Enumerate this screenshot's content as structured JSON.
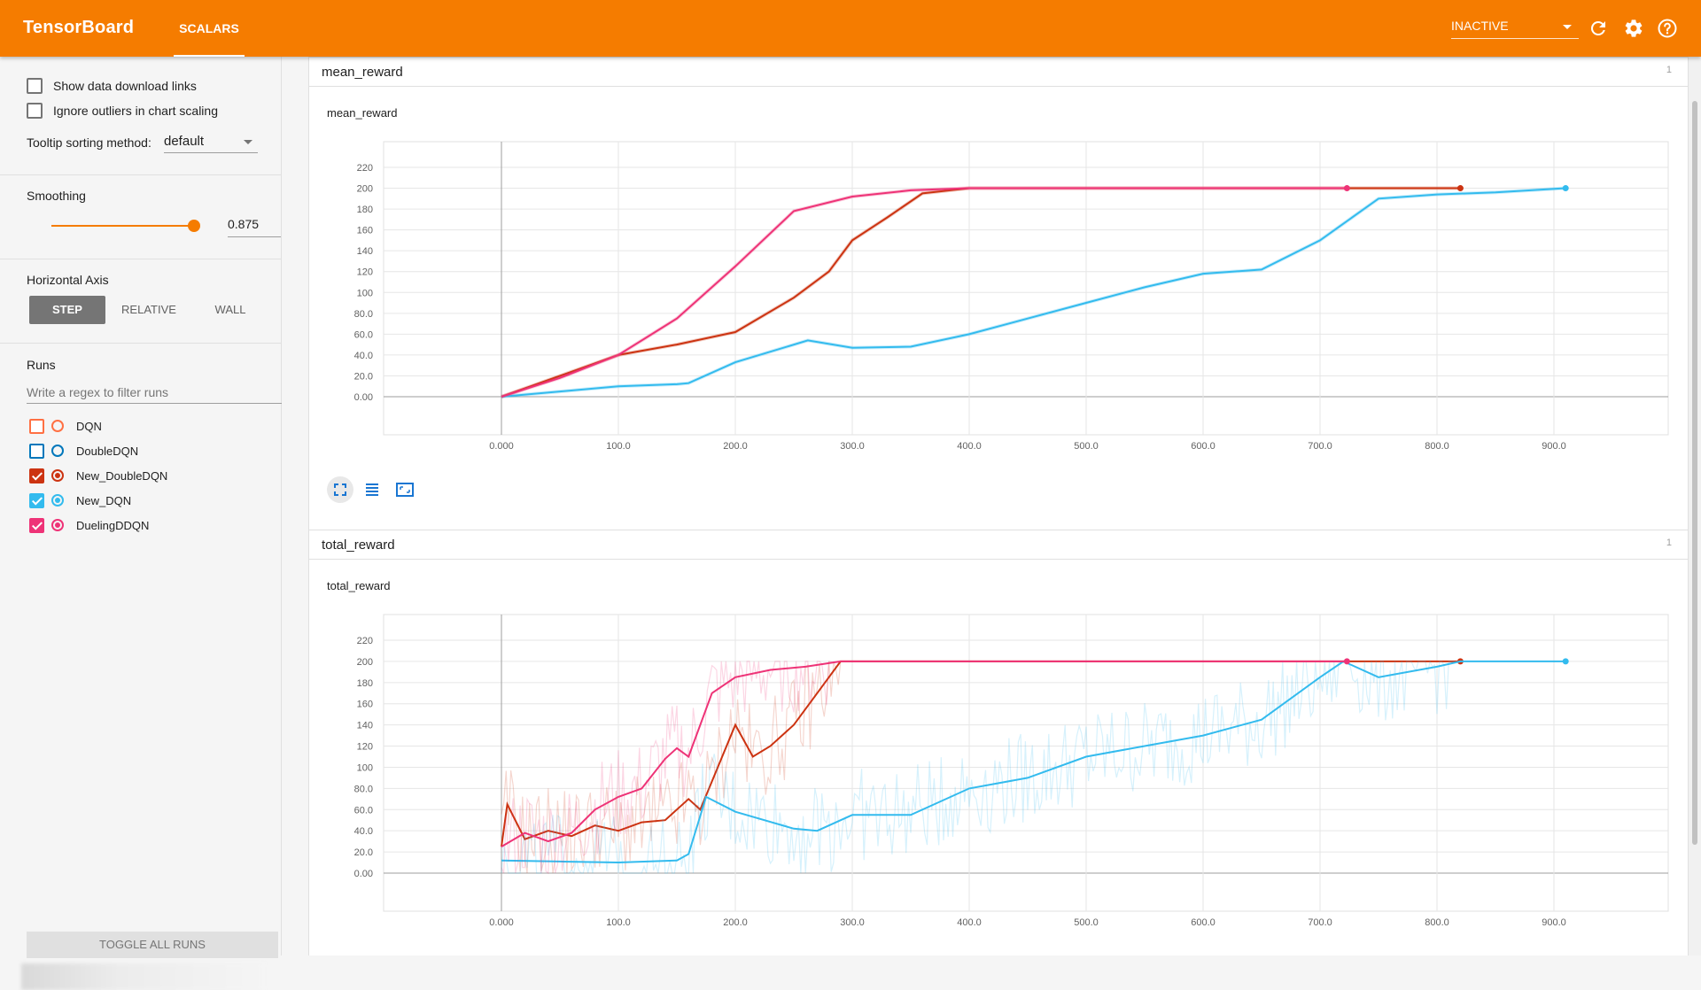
{
  "header": {
    "brand": "TensorBoard",
    "tab_label": "SCALARS",
    "status_value": "INACTIVE",
    "accent": "#f57c00"
  },
  "sidebar": {
    "show_download_label": "Show data download links",
    "ignore_outliers_label": "Ignore outliers in chart scaling",
    "tooltip_label": "Tooltip sorting method:",
    "tooltip_value": "default",
    "smoothing_label": "Smoothing",
    "smoothing_value": "0.875",
    "axis_label": "Horizontal Axis",
    "axis_options": [
      "STEP",
      "RELATIVE",
      "WALL"
    ],
    "runs_label": "Runs",
    "filter_placeholder": "Write a regex to filter runs",
    "runs": [
      {
        "name": "DQN",
        "color": "#ff7043",
        "checked": false
      },
      {
        "name": "DoubleDQN",
        "color": "#0077bb",
        "checked": false
      },
      {
        "name": "New_DoubleDQN",
        "color": "#cc3311",
        "checked": true
      },
      {
        "name": "New_DQN",
        "color": "#33bbee",
        "checked": true
      },
      {
        "name": "DuelingDDQN",
        "color": "#ee3377",
        "checked": true
      }
    ],
    "toggle_all_label": "TOGGLE ALL RUNS"
  },
  "cards": [
    {
      "title": "mean_reward",
      "count": "1",
      "chart_title": "mean_reward"
    },
    {
      "title": "total_reward",
      "count": "1",
      "chart_title": "total_reward"
    }
  ],
  "chart_data": [
    {
      "type": "line",
      "title": "mean_reward",
      "xlim": [
        0,
        1000
      ],
      "ylim": [
        0,
        220
      ],
      "x_ticks": [
        "0.000",
        "100.0",
        "200.0",
        "300.0",
        "400.0",
        "500.0",
        "600.0",
        "700.0",
        "800.0",
        "900.0"
      ],
      "y_ticks": [
        "0.00",
        "20.0",
        "40.0",
        "60.0",
        "80.0",
        "100",
        "120",
        "140",
        "160",
        "180",
        "200",
        "220"
      ],
      "grid": true,
      "series": [
        {
          "name": "New_DoubleDQN",
          "color": "#cc3311",
          "x": [
            0,
            50,
            100,
            150,
            200,
            250,
            280,
            300,
            330,
            360,
            400,
            500,
            600,
            700,
            820
          ],
          "y": [
            0,
            20,
            40,
            50,
            62,
            95,
            120,
            150,
            172,
            195,
            200,
            200,
            200,
            200,
            200
          ]
        },
        {
          "name": "New_DQN",
          "color": "#33bbee",
          "x": [
            0,
            50,
            100,
            150,
            160,
            200,
            262,
            300,
            350,
            400,
            450,
            500,
            550,
            600,
            650,
            700,
            750,
            800,
            850,
            910
          ],
          "y": [
            0,
            5,
            10,
            12,
            13,
            33,
            54,
            47,
            48,
            60,
            75,
            90,
            105,
            118,
            122,
            150,
            190,
            194,
            196,
            200
          ]
        },
        {
          "name": "DuelingDDQN",
          "color": "#ee3377",
          "x": [
            0,
            50,
            100,
            150,
            200,
            250,
            300,
            350,
            400,
            500,
            600,
            723
          ],
          "y": [
            0,
            18,
            40,
            75,
            125,
            178,
            192,
            198,
            200,
            200,
            200,
            200
          ]
        }
      ]
    },
    {
      "type": "line",
      "title": "total_reward",
      "xlim": [
        0,
        1000
      ],
      "ylim": [
        0,
        220
      ],
      "x_ticks": [
        "0.000",
        "100.0",
        "200.0",
        "300.0",
        "400.0",
        "500.0",
        "600.0",
        "700.0",
        "800.0",
        "900.0"
      ],
      "y_ticks": [
        "0.00",
        "20.0",
        "40.0",
        "60.0",
        "80.0",
        "100",
        "120",
        "140",
        "160",
        "180",
        "200",
        "220"
      ],
      "grid": true,
      "series": [
        {
          "name": "New_DoubleDQN",
          "color": "#cc3311",
          "x": [
            0,
            5,
            20,
            40,
            60,
            80,
            100,
            120,
            140,
            160,
            170,
            185,
            200,
            215,
            230,
            250,
            270,
            290,
            310,
            340,
            400,
            500,
            600,
            700,
            820
          ],
          "y": [
            25,
            65,
            32,
            40,
            35,
            45,
            40,
            48,
            50,
            70,
            60,
            100,
            140,
            110,
            120,
            140,
            170,
            200,
            200,
            200,
            200,
            200,
            200,
            200,
            200
          ]
        },
        {
          "name": "New_DQN",
          "color": "#33bbee",
          "x": [
            0,
            50,
            100,
            150,
            160,
            175,
            200,
            250,
            270,
            300,
            350,
            400,
            450,
            500,
            550,
            600,
            650,
            700,
            720,
            750,
            800,
            820,
            910
          ],
          "y": [
            12,
            11,
            10,
            12,
            18,
            72,
            58,
            42,
            40,
            55,
            55,
            80,
            90,
            110,
            120,
            130,
            145,
            185,
            200,
            185,
            195,
            200,
            200
          ]
        },
        {
          "name": "DuelingDDQN",
          "color": "#ee3377",
          "x": [
            0,
            20,
            40,
            60,
            80,
            100,
            120,
            140,
            150,
            160,
            180,
            200,
            230,
            260,
            290,
            320,
            400,
            500,
            600,
            723
          ],
          "y": [
            25,
            38,
            30,
            38,
            60,
            72,
            80,
            108,
            118,
            110,
            170,
            185,
            192,
            195,
            200,
            200,
            200,
            200,
            200,
            200
          ]
        }
      ]
    }
  ]
}
